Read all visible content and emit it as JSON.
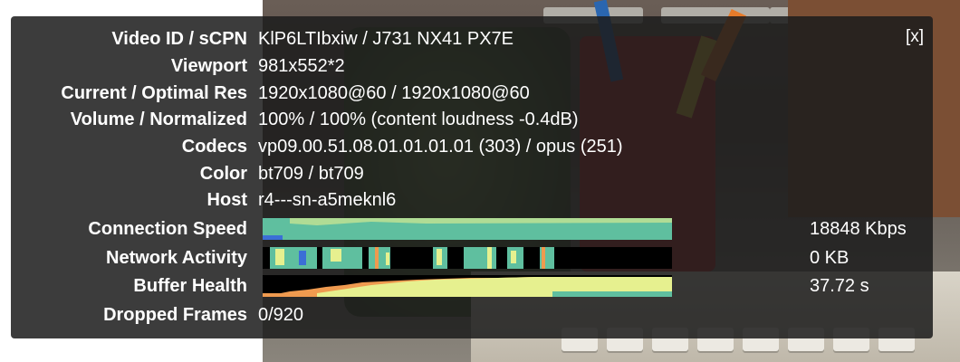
{
  "panel": {
    "close_label": "[x]",
    "rows": [
      {
        "label": "Video ID / sCPN",
        "value": "KlP6LTIbxiw / J731 NX41 PX7E"
      },
      {
        "label": "Viewport",
        "value": "981x552*2"
      },
      {
        "label": "Current / Optimal Res",
        "value": "1920x1080@60 / 1920x1080@60"
      },
      {
        "label": "Volume / Normalized",
        "value": "100% / 100% (content loudness -0.4dB)"
      },
      {
        "label": "Codecs",
        "value": "vp09.00.51.08.01.01.01.01 (303) / opus (251)"
      },
      {
        "label": "Color",
        "value": "bt709 / bt709"
      },
      {
        "label": "Host",
        "value": "r4---sn-a5meknl6"
      }
    ],
    "graphs": [
      {
        "label": "Connection Speed",
        "value": "18848 Kbps"
      },
      {
        "label": "Network Activity",
        "value": "0 KB"
      },
      {
        "label": "Buffer Health",
        "value": "37.72 s"
      }
    ],
    "dropped_frames": {
      "label": "Dropped Frames",
      "value": "0/920"
    }
  },
  "colors": {
    "panel_bg": "#1c1c1c",
    "graph_teal": "#5fbf9f",
    "graph_yellow": "#e6f08f",
    "graph_orange": "#ef9a4f",
    "graph_blue": "#3b6fd6"
  }
}
